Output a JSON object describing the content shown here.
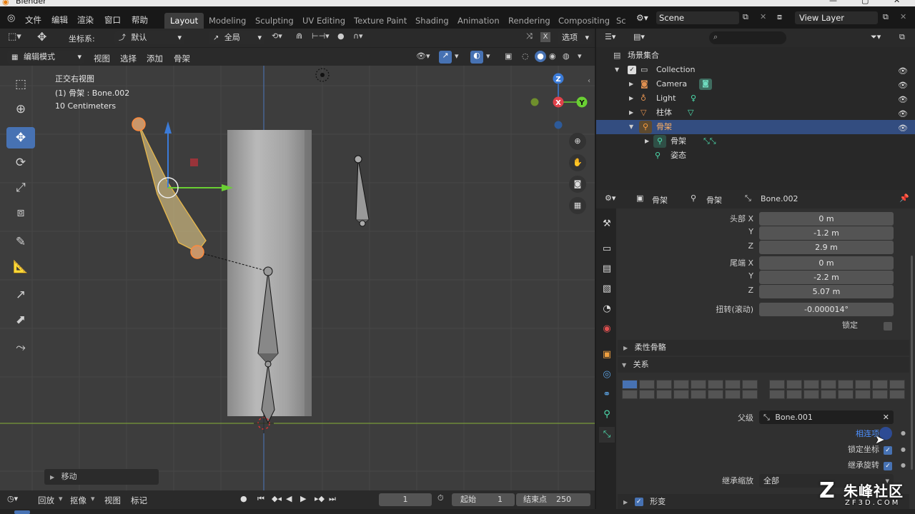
{
  "titlebar": {
    "app": "Blender"
  },
  "menubar": {
    "items": [
      "文件",
      "编辑",
      "渲染",
      "窗口",
      "帮助"
    ],
    "tabs": [
      "Layout",
      "Modeling",
      "Sculpting",
      "UV Editing",
      "Texture Paint",
      "Shading",
      "Animation",
      "Rendering",
      "Compositing",
      "Sc"
    ],
    "scene": "Scene",
    "view_layer": "View Layer"
  },
  "viewport_header": {
    "coord_label": "坐标系:",
    "coord_value": "默认",
    "pivot_value": "全局",
    "options_label": "选项",
    "mode": "编辑模式",
    "menus": [
      "视图",
      "选择",
      "添加",
      "骨架"
    ]
  },
  "viewport_overlay": {
    "view_name": "正交右视图",
    "object_info": "(1) 骨架 : Bone.002",
    "scale_info": "10 Centimeters",
    "last_op": "移动"
  },
  "gizmo": {
    "z": "Z",
    "x": "X",
    "y": "Y"
  },
  "outliner": {
    "root": "场景集合",
    "collection": "Collection",
    "items": [
      {
        "label": "Camera",
        "icon": "camera-icon"
      },
      {
        "label": "Light",
        "icon": "light-icon"
      },
      {
        "label": "柱体",
        "icon": "mesh-icon"
      },
      {
        "label": "骨架",
        "icon": "armature-icon"
      },
      {
        "label": "骨架",
        "icon": "armature-data-icon"
      },
      {
        "label": "姿态",
        "icon": "pose-icon"
      }
    ]
  },
  "properties": {
    "breadcrumb": [
      "骨架",
      "骨架",
      "Bone.002"
    ],
    "head_label": "头部 X",
    "tail_label": "尾端 X",
    "y_label": "Y",
    "z_label": "Z",
    "head": [
      "0 m",
      "-1.2 m",
      "2.9 m"
    ],
    "tail": [
      "0 m",
      "-2.2 m",
      "5.07 m"
    ],
    "roll_label": "扭转(滚动)",
    "roll_value": "-0.000014°",
    "lock_label": "锁定",
    "bbone_label": "柔性骨骼",
    "relations_label": "关系",
    "parent_label": "父级",
    "parent_value": "Bone.001",
    "connected_label": "相连项",
    "local_location_label": "锁定坐标",
    "inherit_rotation_label": "继承旋转",
    "inherit_scale_label": "继承缩放",
    "inherit_scale_value": "全部",
    "deform_label": "形变"
  },
  "timeline": {
    "menus": [
      "回放",
      "抠像",
      "视图",
      "标记"
    ],
    "current_frame": "1",
    "start_label": "起始",
    "start_value": "1",
    "end_label": "结束点",
    "end_value": "250"
  },
  "watermark": {
    "brand": "朱峰社区",
    "url": "ZF3D.COM"
  }
}
